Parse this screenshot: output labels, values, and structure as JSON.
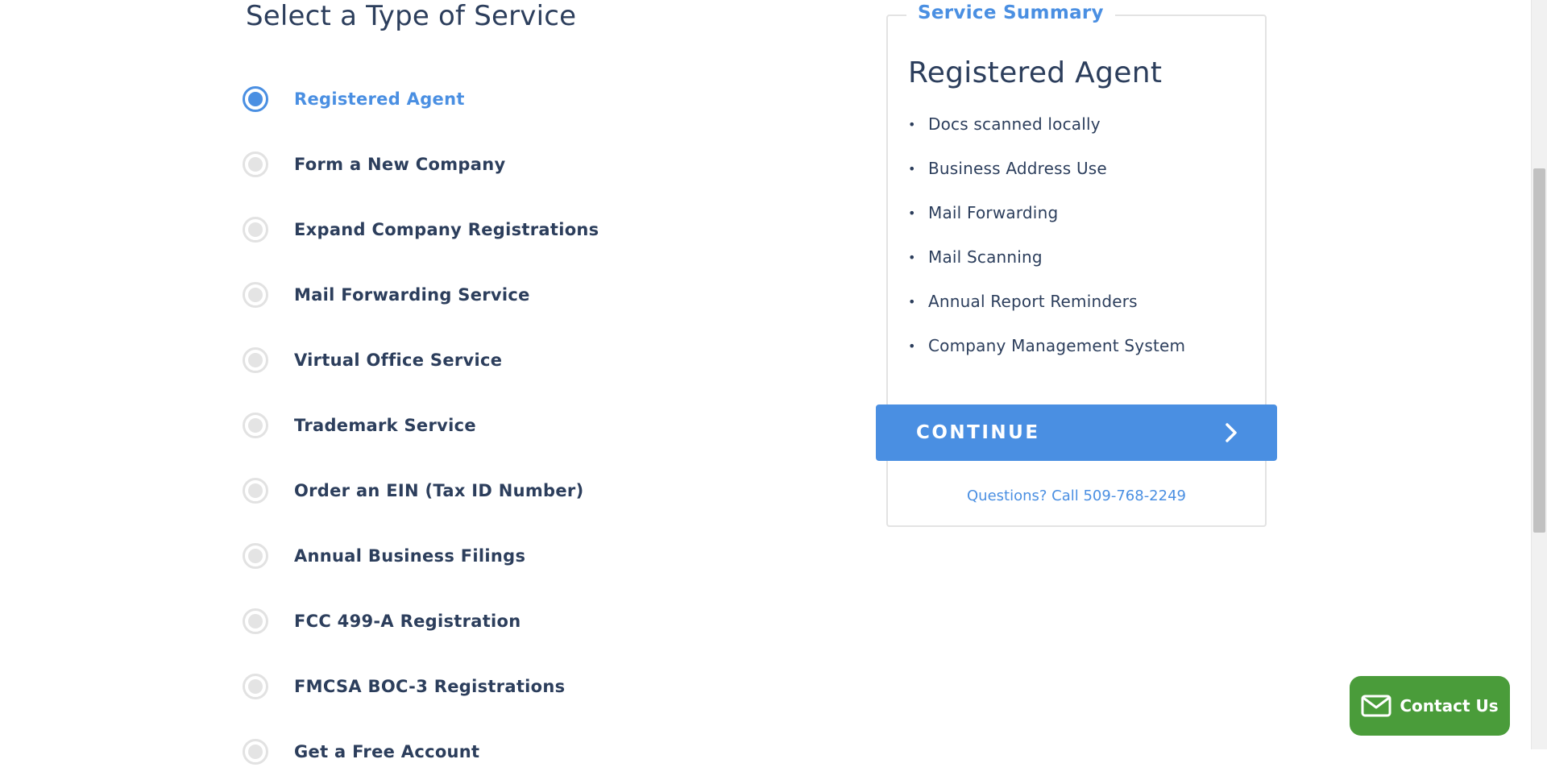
{
  "page": {
    "title": "Select a Type of Service"
  },
  "services": {
    "selected_index": 0,
    "options": [
      {
        "label": "Registered Agent",
        "selected": true
      },
      {
        "label": "Form a New Company",
        "selected": false
      },
      {
        "label": "Expand Company Registrations",
        "selected": false
      },
      {
        "label": "Mail Forwarding Service",
        "selected": false
      },
      {
        "label": "Virtual Office Service",
        "selected": false
      },
      {
        "label": "Trademark Service",
        "selected": false
      },
      {
        "label": "Order an EIN (Tax ID Number)",
        "selected": false
      },
      {
        "label": "Annual Business Filings",
        "selected": false
      },
      {
        "label": "FCC 499-A Registration",
        "selected": false
      },
      {
        "label": "FMCSA BOC-3 Registrations",
        "selected": false
      },
      {
        "label": "Get a Free Account",
        "selected": false
      }
    ]
  },
  "summary": {
    "legend": "Service Summary",
    "heading": "Registered Agent",
    "features": [
      "Docs scanned locally",
      "Business Address Use",
      "Mail Forwarding",
      "Mail Scanning",
      "Annual Report Reminders",
      "Company Management System"
    ],
    "continue_label": "CONTINUE",
    "phone_text": "Questions? Call 509-768-2249"
  },
  "contact": {
    "label": "Contact Us"
  },
  "icons": {
    "radio": "radio-button-icon",
    "continue": "chevron-right-icon",
    "contact": "envelope-icon"
  },
  "colors": {
    "accent": "#4a8fe2",
    "text": "#2c3e5c",
    "contact_button": "#4a9c3a",
    "radio_unselected": "#e4e4e4"
  }
}
